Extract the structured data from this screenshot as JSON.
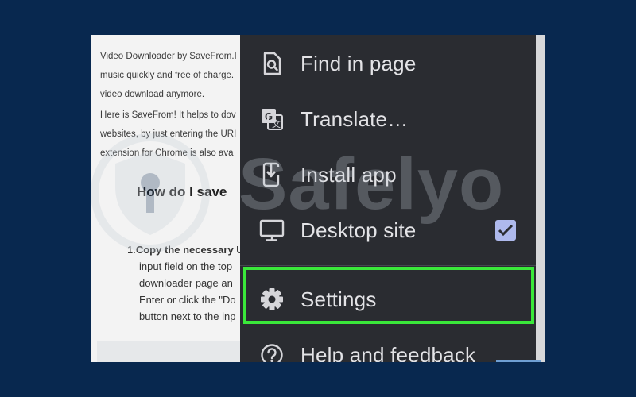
{
  "page": {
    "lines": [
      "Video Downloader by SaveFrom.I",
      "music quickly and free of charge.",
      "video download anymore.",
      "Here is SaveFrom! It helps to dov",
      "websites, by just entering the URI",
      "extension for Chrome is also ava"
    ],
    "heading": "How do I save",
    "step": {
      "number": "1.",
      "bold": "Copy the necessary U",
      "lines": [
        "input field on the top",
        "downloader page an",
        "Enter or click the \"Do",
        "button next to the inp"
      ]
    }
  },
  "menu": {
    "items": [
      {
        "label": "Find in page",
        "icon": "find-in-page-icon"
      },
      {
        "label": "Translate…",
        "icon": "translate-icon"
      },
      {
        "label": "Install app",
        "icon": "install-app-icon"
      },
      {
        "label": "Desktop site",
        "icon": "desktop-icon",
        "checked": true
      },
      {
        "label": "Settings",
        "icon": "gear-icon",
        "highlighted": true
      },
      {
        "label": "Help and feedback",
        "icon": "help-icon"
      }
    ]
  },
  "watermark": {
    "text": "Safelyo"
  },
  "colors": {
    "background": "#08284f",
    "menu_bg": "#2a2c31",
    "menu_text": "#e3e3e6",
    "highlight": "#3ae83a",
    "checkbox": "#aeb9ec"
  }
}
